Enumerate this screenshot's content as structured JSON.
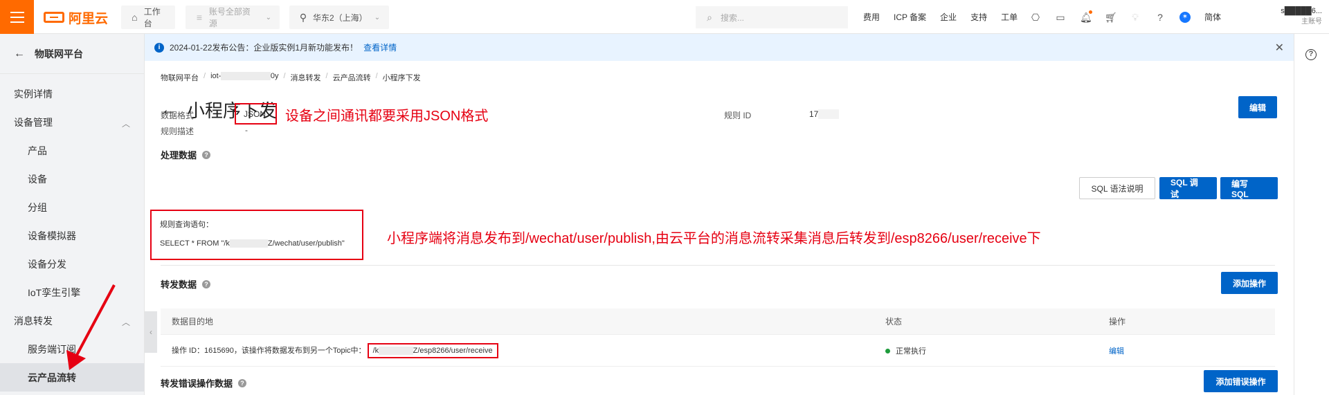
{
  "topbar": {
    "logo_text": "阿里云",
    "workbench": "工作台",
    "resources": "账号全部资源",
    "region": "华东2（上海）",
    "search_placeholder": "搜索...",
    "nav": [
      "费用",
      "ICP 备案",
      "企业",
      "支持",
      "工单"
    ],
    "lang": "简体",
    "user_name": "s█████6...",
    "user_sub": "主账号",
    "accent": "#ff6a00"
  },
  "sidebar": {
    "back_label": "物联网平台",
    "items": [
      {
        "label": "实例详情",
        "type": "top"
      },
      {
        "label": "设备管理",
        "type": "group"
      },
      {
        "label": "产品",
        "type": "sub"
      },
      {
        "label": "设备",
        "type": "sub"
      },
      {
        "label": "分组",
        "type": "sub"
      },
      {
        "label": "设备模拟器",
        "type": "sub"
      },
      {
        "label": "设备分发",
        "type": "sub"
      },
      {
        "label": "IoT孪生引擎",
        "type": "sub"
      },
      {
        "label": "消息转发",
        "type": "group"
      },
      {
        "label": "服务端订阅",
        "type": "sub"
      },
      {
        "label": "云产品流转",
        "type": "sub-active"
      }
    ]
  },
  "notice": {
    "text": "2024-01-22发布公告：企业版实例1月新功能发布！",
    "link": "查看详情"
  },
  "breadcrumb": [
    "物联网平台",
    "iot-",
    "0y",
    "消息转发",
    "云产品流转",
    "小程序下发"
  ],
  "page": {
    "title": "小程序下发",
    "edit_button": "编辑",
    "data_format_label": "数据格式",
    "data_format_value": "JSON",
    "rule_desc_label": "规则描述",
    "rule_desc_value": "-",
    "rule_id_label": "规则 ID",
    "rule_id_value": "17"
  },
  "process": {
    "title": "处理数据",
    "sql_help": "SQL 语法说明",
    "sql_debug": "SQL 调试",
    "sql_edit": "编写 SQL",
    "query_label": "规则查询语句：",
    "query_prefix": "SELECT * FROM \"/k",
    "query_suffix": "Z/wechat/user/publish\""
  },
  "forward": {
    "title": "转发数据",
    "add_button": "添加操作",
    "headers": [
      "数据目的地",
      "状态",
      "操作"
    ],
    "row": {
      "desc": "操作 ID：1615690，该操作将数据发布到另一个Topic中：",
      "topic_prefix": "/k",
      "topic_suffix": "Z/esp8266/user/receive",
      "status": "正常执行",
      "action": "编辑"
    },
    "status_color": "#1e9b3c"
  },
  "error_forward": {
    "title": "转发错误操作数据",
    "add_button": "添加错误操作"
  },
  "annotations": {
    "json_note": "设备之间通讯都要采用JSON格式",
    "flow_note": "小程序端将消息发布到/wechat/user/publish,由云平台的消息流转采集消息后转发到/esp8266/user/receive下",
    "color": "#e60012"
  }
}
